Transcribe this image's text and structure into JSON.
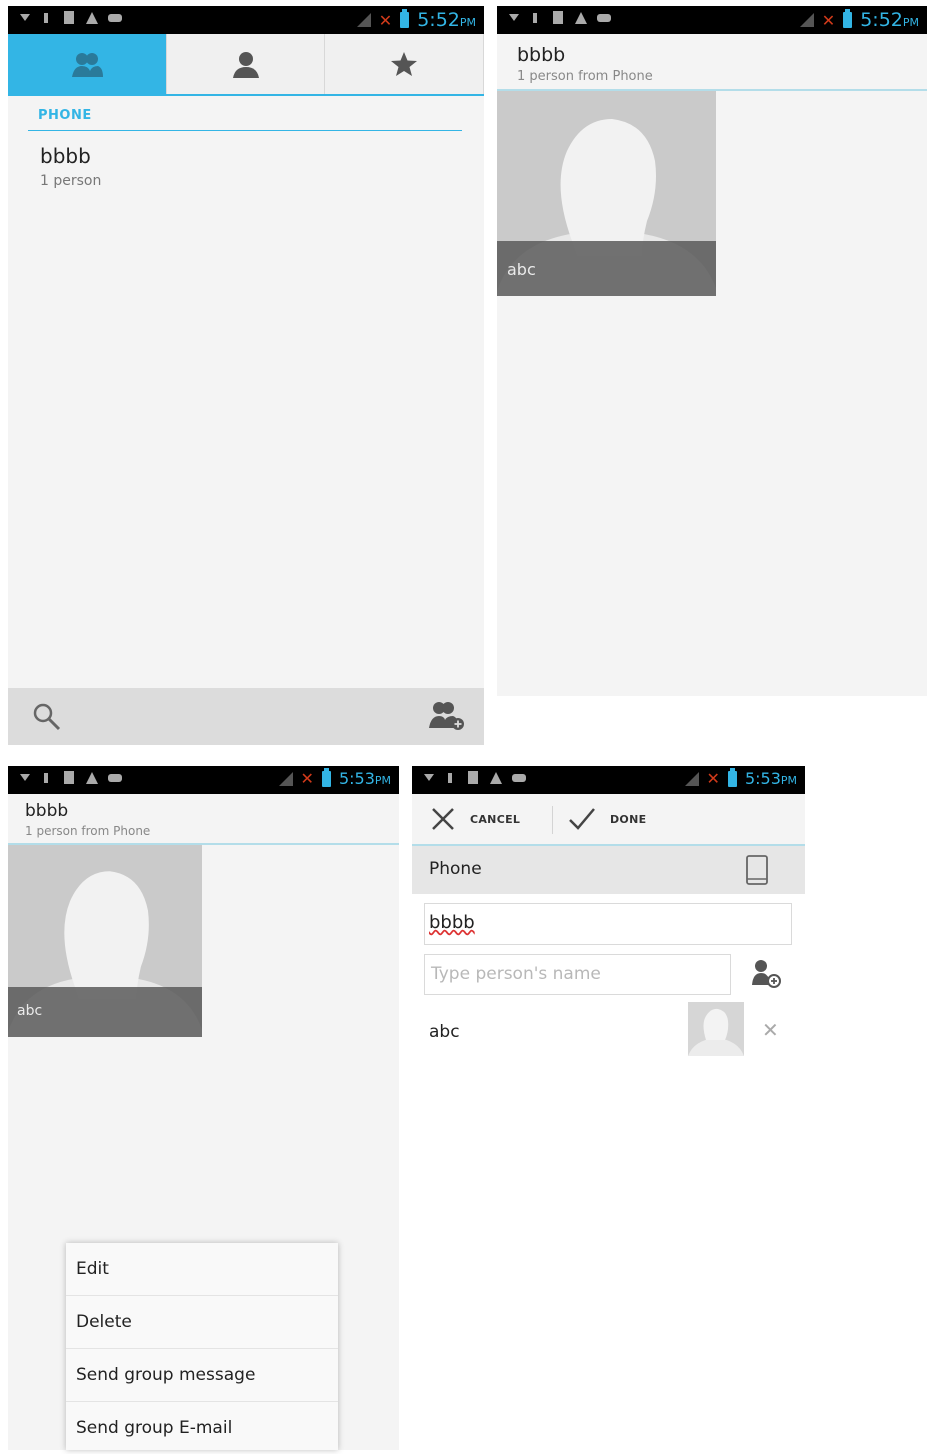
{
  "status_bar": {
    "screen1_time": "5:52",
    "screen2_time": "5:52",
    "screen3_time": "5:53",
    "screen4_time": "5:53",
    "ampm": "PM"
  },
  "screen1": {
    "tabs": [
      {
        "icon": "groups-icon",
        "active": true
      },
      {
        "icon": "person-icon",
        "active": false
      },
      {
        "icon": "star-icon",
        "active": false
      }
    ],
    "section": "PHONE",
    "group": {
      "name": "bbbb",
      "count": "1 person"
    }
  },
  "screen2": {
    "title": "bbbb",
    "subtitle": "1 person from Phone",
    "contact_label": "abc"
  },
  "screen3": {
    "title": "bbbb",
    "subtitle": "1 person from Phone",
    "contact_label": "abc",
    "menu": [
      "Edit",
      "Delete",
      "Send group message",
      "Send group E-mail"
    ]
  },
  "screen4": {
    "cancel_label": "CANCEL",
    "done_label": "DONE",
    "account_label": "Phone",
    "group_name_value": "bbbb",
    "person_placeholder": "Type person's name",
    "member_name": "abc"
  },
  "colors": {
    "accent": "#33b5e5",
    "background": "#f4f4f4"
  }
}
